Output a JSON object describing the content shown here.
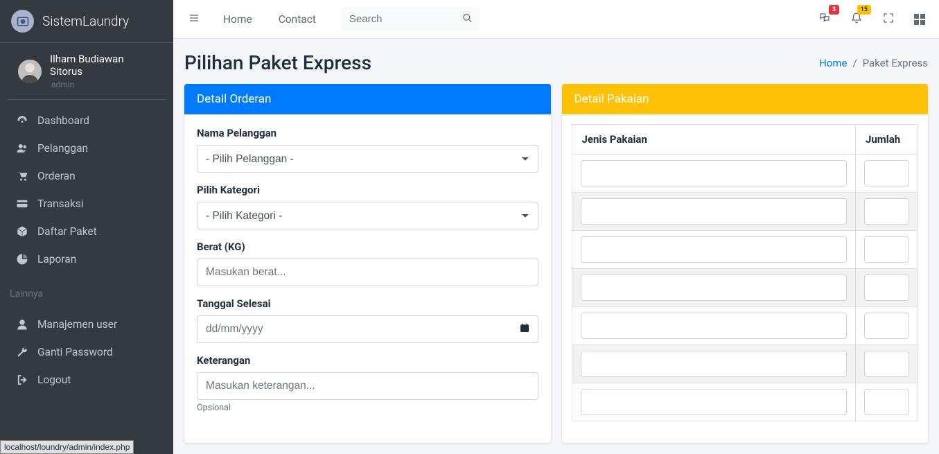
{
  "brand": {
    "name": "SistemLaundry"
  },
  "user": {
    "name": "Ilham Budiawan Sitorus",
    "role": "admin"
  },
  "sidebar": {
    "items": [
      {
        "label": "Dashboard",
        "icon": "dashboard"
      },
      {
        "label": "Pelanggan",
        "icon": "users"
      },
      {
        "label": "Orderan",
        "icon": "cart"
      },
      {
        "label": "Transaksi",
        "icon": "card"
      },
      {
        "label": "Daftar Paket",
        "icon": "box"
      },
      {
        "label": "Laporan",
        "icon": "chart"
      }
    ],
    "section_header": "Lainnya",
    "items2": [
      {
        "label": "Manajemen user",
        "icon": "user"
      },
      {
        "label": "Ganti Password",
        "icon": "wrench"
      },
      {
        "label": "Logout",
        "icon": "logout"
      }
    ]
  },
  "topbar": {
    "links": [
      "Home",
      "Contact"
    ],
    "search_placeholder": "Search",
    "badge_chat": "3",
    "badge_bell": "15"
  },
  "page": {
    "title": "Pilihan Paket Express",
    "breadcrumb": {
      "home": "Home",
      "current": "Paket Express"
    }
  },
  "order_card": {
    "title": "Detail Orderan",
    "fields": {
      "nama_label": "Nama Pelanggan",
      "nama_placeholder": "- Pilih Pelanggan -",
      "kategori_label": "Pilih Kategori",
      "kategori_placeholder": "- Pilih Kategori -",
      "berat_label": "Berat (KG)",
      "berat_placeholder": "Masukan berat...",
      "tanggal_label": "Tanggal Selesai",
      "tanggal_placeholder": "dd/mm/yyyy",
      "ket_label": "Keterangan",
      "ket_placeholder": "Masukan keterangan...",
      "ket_help": "Opsional"
    }
  },
  "pakaian_card": {
    "title": "Detail Pakaian",
    "col_jenis": "Jenis Pakaian",
    "col_jumlah": "Jumlah",
    "row_count": 7
  },
  "status_bar": "localhost/loundry/admin/index.php"
}
